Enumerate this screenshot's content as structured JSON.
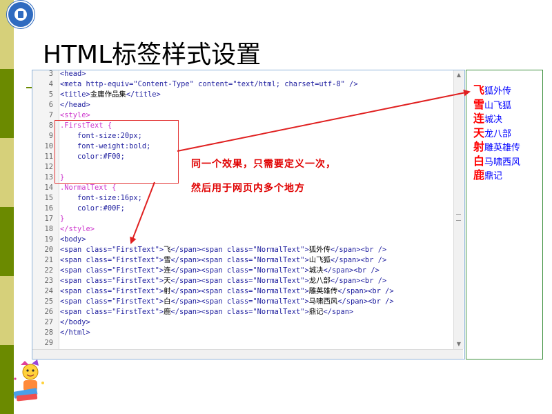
{
  "slide": {
    "title": "HTML标签样式设置",
    "colors": {
      "stripe": [
        "#d6d07a",
        "#6b8a00",
        "#d6d07a",
        "#6b8a00",
        "#d6d07a",
        "#6b8a00"
      ],
      "title_text": "#000000",
      "annotation": "#e00000",
      "first_text": "#ff0000",
      "normal_text": "#0000ff"
    },
    "logo_icon": "university-logo-icon",
    "mascot_icon": "cartoon-mascot-icon"
  },
  "editor": {
    "lines": [
      {
        "n": "3",
        "parts": [
          {
            "c": "tag",
            "t": "<head>"
          }
        ]
      },
      {
        "n": "4",
        "parts": [
          {
            "c": "tag",
            "t": "<meta http-equiv=\"Content-Type\" content=\"text/html; charset=utf-8\" />"
          }
        ]
      },
      {
        "n": "5",
        "parts": [
          {
            "c": "tag",
            "t": "<title>"
          },
          {
            "c": "txt",
            "t": "金庸作品集"
          },
          {
            "c": "tag",
            "t": "</title>"
          }
        ]
      },
      {
        "n": "6",
        "parts": [
          {
            "c": "tag",
            "t": "</head>"
          }
        ]
      },
      {
        "n": "7",
        "parts": [
          {
            "c": "css",
            "t": "<style>"
          }
        ]
      },
      {
        "n": "8",
        "parts": [
          {
            "c": "css",
            "t": ".FirstText {"
          }
        ]
      },
      {
        "n": "9",
        "parts": [
          {
            "c": "attrv",
            "t": "    font-size:20px;"
          }
        ]
      },
      {
        "n": "10",
        "parts": [
          {
            "c": "attrv",
            "t": "    font-weight:bold;"
          }
        ]
      },
      {
        "n": "11",
        "parts": [
          {
            "c": "attrv",
            "t": "    color:#F00;"
          }
        ]
      },
      {
        "n": "12",
        "parts": [
          {
            "c": "txt",
            "t": ""
          }
        ]
      },
      {
        "n": "13",
        "parts": [
          {
            "c": "css",
            "t": "}"
          }
        ]
      },
      {
        "n": "14",
        "parts": [
          {
            "c": "css",
            "t": ".NormalText {"
          }
        ]
      },
      {
        "n": "15",
        "parts": [
          {
            "c": "attrv",
            "t": "    font-size:16px;"
          }
        ]
      },
      {
        "n": "16",
        "parts": [
          {
            "c": "attrv",
            "t": "    color:#00F;"
          }
        ]
      },
      {
        "n": "17",
        "parts": [
          {
            "c": "css",
            "t": "}"
          }
        ]
      },
      {
        "n": "18",
        "parts": [
          {
            "c": "css",
            "t": "</style>"
          }
        ]
      },
      {
        "n": "19",
        "parts": [
          {
            "c": "tag",
            "t": "<body>"
          }
        ]
      },
      {
        "n": "20",
        "parts": [
          {
            "c": "tag",
            "t": "<span class=\"FirstText\">"
          },
          {
            "c": "txt",
            "t": "飞"
          },
          {
            "c": "tag",
            "t": "</span><span class=\"NormalText\">"
          },
          {
            "c": "txt",
            "t": "狐外传"
          },
          {
            "c": "tag",
            "t": "</span><br />"
          }
        ]
      },
      {
        "n": "21",
        "parts": [
          {
            "c": "tag",
            "t": "<span class=\"FirstText\">"
          },
          {
            "c": "txt",
            "t": "雪"
          },
          {
            "c": "tag",
            "t": "</span><span class=\"NormalText\">"
          },
          {
            "c": "txt",
            "t": "山飞狐"
          },
          {
            "c": "tag",
            "t": "</span><br />"
          }
        ]
      },
      {
        "n": "22",
        "parts": [
          {
            "c": "tag",
            "t": "<span class=\"FirstText\">"
          },
          {
            "c": "txt",
            "t": "连"
          },
          {
            "c": "tag",
            "t": "</span><span class=\"NormalText\">"
          },
          {
            "c": "txt",
            "t": "城决"
          },
          {
            "c": "tag",
            "t": "</span><br />"
          }
        ]
      },
      {
        "n": "23",
        "parts": [
          {
            "c": "tag",
            "t": "<span class=\"FirstText\">"
          },
          {
            "c": "txt",
            "t": "天"
          },
          {
            "c": "tag",
            "t": "</span><span class=\"NormalText\">"
          },
          {
            "c": "txt",
            "t": "龙八部"
          },
          {
            "c": "tag",
            "t": "</span><br />"
          }
        ]
      },
      {
        "n": "24",
        "parts": [
          {
            "c": "tag",
            "t": "<span class=\"FirstText\">"
          },
          {
            "c": "txt",
            "t": "射"
          },
          {
            "c": "tag",
            "t": "</span><span class=\"NormalText\">"
          },
          {
            "c": "txt",
            "t": "雕英雄传"
          },
          {
            "c": "tag",
            "t": "</span><br />"
          }
        ]
      },
      {
        "n": "25",
        "parts": [
          {
            "c": "tag",
            "t": "<span class=\"FirstText\">"
          },
          {
            "c": "txt",
            "t": "白"
          },
          {
            "c": "tag",
            "t": "</span><span class=\"NormalText\">"
          },
          {
            "c": "txt",
            "t": "马啸西风"
          },
          {
            "c": "tag",
            "t": "</span><br />"
          }
        ]
      },
      {
        "n": "26",
        "parts": [
          {
            "c": "tag",
            "t": "<span class=\"FirstText\">"
          },
          {
            "c": "txt",
            "t": "鹿"
          },
          {
            "c": "tag",
            "t": "</span><span class=\"NormalText\">"
          },
          {
            "c": "txt",
            "t": "鼎记"
          },
          {
            "c": "tag",
            "t": "</span>"
          }
        ]
      },
      {
        "n": "27",
        "parts": [
          {
            "c": "tag",
            "t": "</body>"
          }
        ]
      },
      {
        "n": "28",
        "parts": [
          {
            "c": "tag",
            "t": "</html>"
          }
        ]
      },
      {
        "n": "29",
        "parts": [
          {
            "c": "txt",
            "t": ""
          }
        ]
      }
    ],
    "scroll_up": "▲",
    "scroll_down": "▼"
  },
  "annotation": {
    "line1": "同一个效果，只需要定义一次，",
    "line2": "然后用于网页内多个地方"
  },
  "preview": {
    "items": [
      {
        "first": "飞",
        "rest": "狐外传"
      },
      {
        "first": "雪",
        "rest": "山飞狐"
      },
      {
        "first": "连",
        "rest": "城决"
      },
      {
        "first": "天",
        "rest": "龙八部"
      },
      {
        "first": "射",
        "rest": "雕英雄传"
      },
      {
        "first": "白",
        "rest": "马啸西风"
      },
      {
        "first": "鹿",
        "rest": "鼎记"
      }
    ]
  }
}
